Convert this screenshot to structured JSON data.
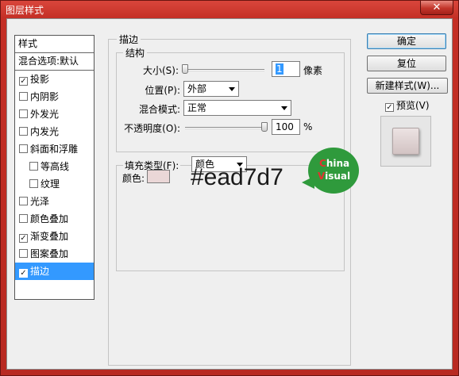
{
  "window": {
    "title": "图层样式",
    "close_label": "✕"
  },
  "left_panel": {
    "styles_header": "样式",
    "blend_header": "混合选项:默认",
    "items": [
      {
        "label": "投影",
        "checked": true,
        "indent": false,
        "selected": false
      },
      {
        "label": "内阴影",
        "checked": false,
        "indent": false,
        "selected": false
      },
      {
        "label": "外发光",
        "checked": false,
        "indent": false,
        "selected": false
      },
      {
        "label": "内发光",
        "checked": false,
        "indent": false,
        "selected": false
      },
      {
        "label": "斜面和浮雕",
        "checked": false,
        "indent": false,
        "selected": false
      },
      {
        "label": "等高线",
        "checked": false,
        "indent": true,
        "selected": false
      },
      {
        "label": "纹理",
        "checked": false,
        "indent": true,
        "selected": false
      },
      {
        "label": "光泽",
        "checked": false,
        "indent": false,
        "selected": false
      },
      {
        "label": "颜色叠加",
        "checked": false,
        "indent": false,
        "selected": false
      },
      {
        "label": "渐变叠加",
        "checked": true,
        "indent": false,
        "selected": false
      },
      {
        "label": "图案叠加",
        "checked": false,
        "indent": false,
        "selected": false
      },
      {
        "label": "描边",
        "checked": true,
        "indent": false,
        "selected": true
      }
    ]
  },
  "stroke": {
    "group_title": "描边",
    "structure_title": "结构",
    "size_label": "大小(S):",
    "size_value": "1",
    "size_unit": "像素",
    "size_slider_fraction": 0.0,
    "position_label": "位置(P):",
    "position_value": "外部",
    "blend_mode_label": "混合模式:",
    "blend_mode_value": "正常",
    "opacity_label": "不透明度(O):",
    "opacity_value": "100",
    "opacity_unit": "%",
    "opacity_slider_fraction": 1.0,
    "fill_type_label": "填充类型(F):",
    "fill_type_value": "颜色",
    "color_label": "颜色:",
    "color_value": "#ead7d7"
  },
  "annotation": {
    "hex_text": "#ead7d7",
    "logo_line1_first": "C",
    "logo_line1_rest": "hina",
    "logo_line2_first": "V",
    "logo_line2_rest": "isual"
  },
  "buttons": {
    "ok": "确定",
    "reset": "复位",
    "new_style": "新建样式(W)...",
    "preview_label": "预览(V)",
    "preview_checked": true
  },
  "colors": {
    "title_bar": "#c42f26",
    "selection": "#3399ff",
    "logo_green": "#2f9a3c",
    "logo_red": "#e4312f"
  }
}
